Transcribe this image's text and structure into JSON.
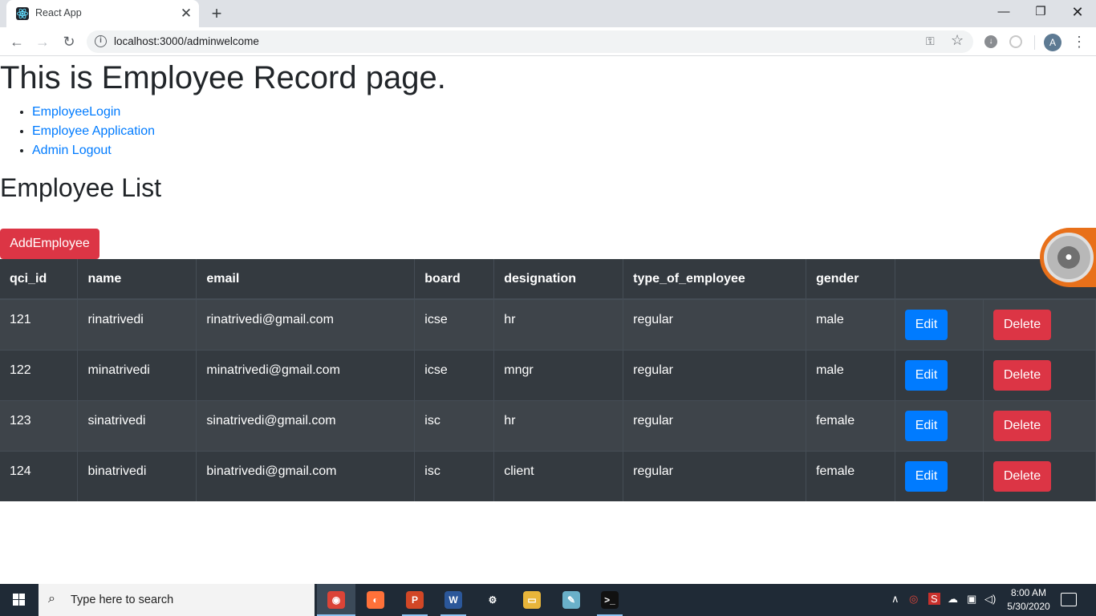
{
  "browser": {
    "tab_title": "React App",
    "tab_close": "✕",
    "new_tab": "+",
    "url": "localhost:3000/adminwelcome",
    "window_min": "—",
    "window_max": "❐",
    "window_close": "✕",
    "profile_initial": "A"
  },
  "page": {
    "title": "This is Employee Record page.",
    "nav_links": [
      "EmployeeLogin",
      "Employee Application",
      "Admin Logout"
    ],
    "section_title": "Employee List",
    "add_button": "AddEmployee"
  },
  "table": {
    "headers": [
      "qci_id",
      "name",
      "email",
      "board",
      "designation",
      "type_of_employee",
      "gender",
      ""
    ],
    "rows": [
      {
        "qci_id": "121",
        "name": "rinatrivedi",
        "email": "rinatrivedi@gmail.com",
        "board": "icse",
        "designation": "hr",
        "type_of_employee": "regular",
        "gender": "male"
      },
      {
        "qci_id": "122",
        "name": "minatrivedi",
        "email": "minatrivedi@gmail.com",
        "board": "icse",
        "designation": "mngr",
        "type_of_employee": "regular",
        "gender": "male"
      },
      {
        "qci_id": "123",
        "name": "sinatrivedi",
        "email": "sinatrivedi@gmail.com",
        "board": "isc",
        "designation": "hr",
        "type_of_employee": "regular",
        "gender": "female"
      },
      {
        "qci_id": "124",
        "name": "binatrivedi",
        "email": "binatrivedi@gmail.com",
        "board": "isc",
        "designation": "client",
        "type_of_employee": "regular",
        "gender": "female"
      }
    ],
    "edit_label": "Edit",
    "delete_label": "Delete"
  },
  "taskbar": {
    "search_placeholder": "Type here to search",
    "apps": [
      {
        "icon": "chrome-icon",
        "glyph": "◉",
        "color": "#db4437",
        "state": "active"
      },
      {
        "icon": "firefox-icon",
        "glyph": "◐",
        "color": "#ff7139",
        "state": "none"
      },
      {
        "icon": "powerpoint-icon",
        "glyph": "P",
        "color": "#d24726",
        "state": "running"
      },
      {
        "icon": "word-icon",
        "glyph": "W",
        "color": "#2b579a",
        "state": "running"
      },
      {
        "icon": "settings-icon",
        "glyph": "⚙",
        "color": "#1f2a36",
        "state": "none"
      },
      {
        "icon": "file-explorer-icon",
        "glyph": "▭",
        "color": "#e8b53a",
        "state": "none"
      },
      {
        "icon": "notepad-icon",
        "glyph": "✎",
        "color": "#6ab0c9",
        "state": "none"
      },
      {
        "icon": "terminal-icon",
        "glyph": ">_",
        "color": "#111111",
        "state": "running"
      }
    ],
    "time": "8:00 AM",
    "date": "5/30/2020"
  },
  "colors": {
    "primary": "#007bff",
    "danger": "#dc3545",
    "table_dark": "#343a40"
  }
}
